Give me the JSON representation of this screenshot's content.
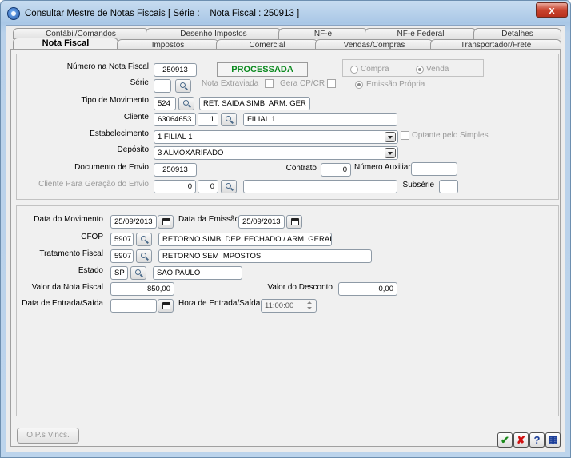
{
  "window": {
    "title": "Consultar Mestre de Notas Fiscais [ Série :    Nota Fiscal : 250913 ]",
    "close_label": "x"
  },
  "tabs": {
    "back_row": [
      "Contábil/Comandos",
      "Desenho Impostos",
      "NF-e",
      "NF-e Federal",
      "Detalhes"
    ],
    "front_row": [
      "Nota Fiscal",
      "Impostos",
      "Comercial",
      "Vendas/Compras",
      "Transportador/Frete"
    ],
    "active": "Nota Fiscal"
  },
  "top": {
    "numero_label": "Número na Nota Fiscal",
    "numero_value": "250913",
    "status": "PROCESSADA",
    "radio_compra": "Compra",
    "radio_venda": "Venda",
    "serie_label": "Série",
    "serie_value": "",
    "nota_extraviada_label": "Nota Extraviada",
    "gera_cpcr_label": "Gera CP/CR",
    "emissao_propria_label": "Emissão Própria",
    "tipo_mov_label": "Tipo de Movimento",
    "tipo_mov_code": "524",
    "tipo_mov_desc": "RET. SAIDA SIMB. ARM. GER",
    "cliente_label": "Cliente",
    "cliente_code": "63064653",
    "cliente_seq": "1",
    "cliente_name": "FILIAL 1",
    "estab_label": "Estabelecimento",
    "estab_value": "1 FILIAL 1",
    "optante_label": "Optante pelo Simples",
    "deposito_label": "Depósito",
    "deposito_value": "3 ALMOXARIFADO",
    "doc_envio_label": "Documento de Envio",
    "doc_envio_value": "250913",
    "contrato_label": "Contrato",
    "contrato_value": "0",
    "num_aux_label": "Número Auxiliar",
    "num_aux_value": "",
    "cliente_ger_label": "Cliente Para Geração do Envio",
    "cliente_ger_code": "0",
    "cliente_ger_seq": "0",
    "cliente_ger_name": "",
    "subserie_label": "Subsérie",
    "subserie_value": ""
  },
  "bottom": {
    "data_mov_label": "Data do Movimento",
    "data_mov_value": "25/09/2013",
    "data_emissao_label": "Data da Emissão",
    "data_emissao_value": "25/09/2013",
    "cfop_label": "CFOP",
    "cfop_code": "5907",
    "cfop_desc": "RETORNO SIMB. DEP. FECHADO / ARM. GERAL",
    "trat_label": "Tratamento Fiscal",
    "trat_code": "5907",
    "trat_desc": "RETORNO SEM IMPOSTOS",
    "estado_label": "Estado",
    "estado_code": "SP",
    "estado_desc": "SAO PAULO",
    "valor_nf_label": "Valor da Nota Fiscal",
    "valor_nf_value": "850,00",
    "valor_desc_label": "Valor do Desconto",
    "valor_desc_value": "0,00",
    "data_es_label": "Data de Entrada/Saída",
    "data_es_value": "",
    "hora_es_label": "Hora de Entrada/Saída",
    "hora_es_value": "11:00:00"
  },
  "footer": {
    "ops_label": "O.P.s Vincs.",
    "ok_glyph": "✔",
    "cancel_glyph": "✘",
    "help_glyph": "?",
    "calc_glyph": "▦"
  },
  "colors": {
    "status_text": "#0b8a1f",
    "ok": "#1c8a1c",
    "cancel": "#d01010",
    "help": "#1c3f9a"
  }
}
